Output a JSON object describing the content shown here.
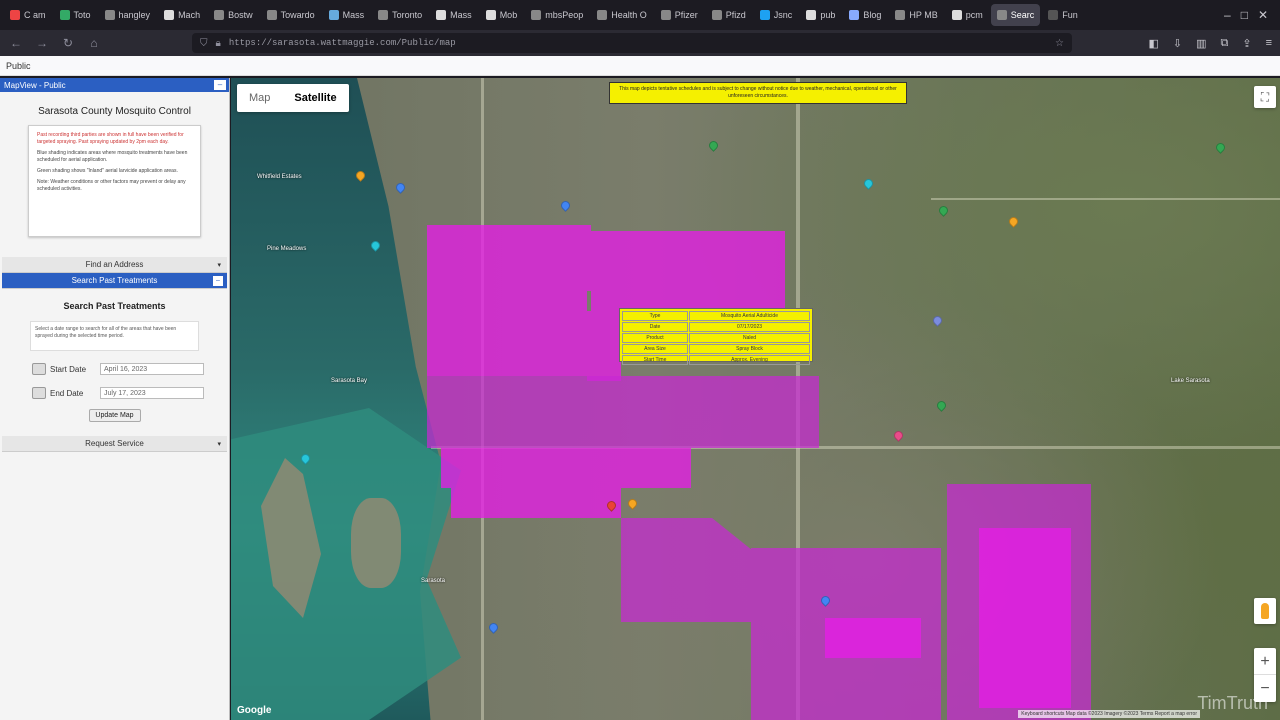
{
  "browser": {
    "tabs": [
      {
        "label": "C am",
        "color": "#e44"
      },
      {
        "label": "Toto",
        "color": "#3a6"
      },
      {
        "label": "hangley",
        "color": "#888"
      },
      {
        "label": "Mach",
        "color": "#ddd"
      },
      {
        "label": "Bostw",
        "color": "#888"
      },
      {
        "label": "Towardo",
        "color": "#888"
      },
      {
        "label": "Mass",
        "color": "#6ad"
      },
      {
        "label": "Toronto",
        "color": "#888"
      },
      {
        "label": "Mass",
        "color": "#ddd"
      },
      {
        "label": "Mob",
        "color": "#ddd"
      },
      {
        "label": "mbsPeop",
        "color": "#888"
      },
      {
        "label": "Health O",
        "color": "#888"
      },
      {
        "label": "Pfizer",
        "color": "#888"
      },
      {
        "label": "Pfizd",
        "color": "#888"
      },
      {
        "label": "Jsnc",
        "color": "#1da1f2"
      },
      {
        "label": "pub",
        "color": "#ddd"
      },
      {
        "label": "Blog",
        "color": "#8af"
      },
      {
        "label": "HP MB",
        "color": "#888"
      },
      {
        "label": "pcm",
        "color": "#ddd"
      },
      {
        "label": "Searc",
        "color": "#888",
        "active": true
      },
      {
        "label": "Fun",
        "color": "#555"
      }
    ],
    "url": "https://sarasota.wattmaggie.com/Public/map",
    "bookmark_label": "Public"
  },
  "panel": {
    "title": "MapView - Public",
    "org_name": "Sarasota County Mosquito Control",
    "notice": {
      "line1": "Past recording third parties are shown in full have been verified for targeted spraying. Past spraying updated by 2pm each day.",
      "line2": "Blue shading indicates areas where mosquito treatments have been scheduled for aerial application.",
      "line3": "Green shading shows \"Inland\" aerial larvicide application areas.",
      "line4": "Note: Weather conditions or other factors may prevent or delay any scheduled activities."
    },
    "find_address": "Find an Address",
    "search_past": "Search Past Treatments",
    "search_heading": "Search Past Treatments",
    "search_desc": "Select a date range to search for all of the areas that have been sprayed during the selected time period.",
    "start_label": "Start Date",
    "start_value": "April 16, 2023",
    "end_label": "End Date",
    "end_value": "July 17, 2023",
    "update_button": "Update Map",
    "request_service": "Request Service"
  },
  "map": {
    "type_map": "Map",
    "type_satellite": "Satellite",
    "selected_type": "Satellite",
    "disclaimer": "This map depicts tentative schedules and is subject to change without notice due to weather, mechanical, operational or other unforeseen circumstances.",
    "popup_rows": [
      {
        "k": "Type",
        "v": "Mosquito Aerial Adulticide"
      },
      {
        "k": "Date",
        "v": "07/17/2023"
      },
      {
        "k": "Product",
        "v": "Naled"
      },
      {
        "k": "Area Size",
        "v": "Spray Block"
      },
      {
        "k": "Start Time",
        "v": "Approx. Evening"
      }
    ],
    "labels": {
      "l1": "Whitfield Estates",
      "l2": "Pine Meadows",
      "l3": "Sarasota Bay",
      "l4": "Lake Sarasota",
      "l5": "Sarasota"
    },
    "attribution": "Keyboard shortcuts  Map data ©2023 Imagery ©2023  Terms  Report a map error",
    "google_logo": "Google",
    "watermark": "TimTruth"
  },
  "colors": {
    "spray_zone": "#e61ee6",
    "panel_header": "#2b5fc2",
    "highlight": "#f5f000"
  }
}
